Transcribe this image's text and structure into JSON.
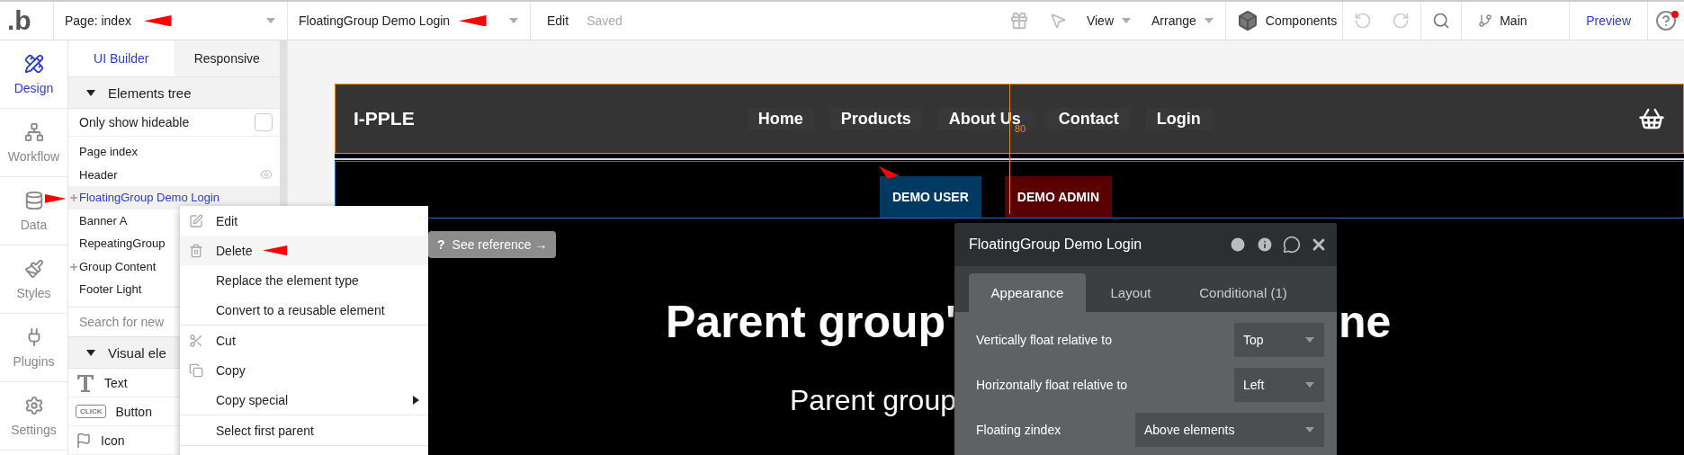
{
  "topbar": {
    "logo": ".b",
    "page_selector": "Page: index",
    "element_selector": "FloatingGroup Demo Login",
    "edit": "Edit",
    "save_status": "Saved",
    "view": "View",
    "arrange": "Arrange",
    "components": "Components",
    "branch": "Main",
    "preview": "Preview",
    "help_badge": true
  },
  "rail": [
    {
      "label": "Design",
      "selected": true
    },
    {
      "label": "Workflow",
      "selected": false
    },
    {
      "label": "Data",
      "selected": false
    },
    {
      "label": "Styles",
      "selected": false
    },
    {
      "label": "Plugins",
      "selected": false
    },
    {
      "label": "Settings",
      "selected": false
    }
  ],
  "panel": {
    "tabs": [
      {
        "label": "UI Builder",
        "selected": true
      },
      {
        "label": "Responsive",
        "selected": false
      }
    ],
    "tree_section": {
      "title": "Elements tree",
      "expanded": true
    },
    "hideable": {
      "label": "Only show hideable",
      "checked": false
    },
    "tree": [
      {
        "label": "Page index",
        "selected": false,
        "expandable": false,
        "eye": false
      },
      {
        "label": "Header",
        "selected": false,
        "expandable": false,
        "eye": true
      },
      {
        "label": "FloatingGroup Demo Login",
        "selected": true,
        "expandable": true,
        "eye": false
      },
      {
        "label": "Banner A",
        "selected": false,
        "expandable": false
      },
      {
        "label": "RepeatingGroup",
        "selected": false,
        "expandable": false
      },
      {
        "label": "Group Content",
        "selected": false,
        "expandable": true
      },
      {
        "label": "Footer Light",
        "selected": false,
        "expandable": false
      }
    ],
    "search": {
      "placeholder": "Search for new"
    },
    "visual_section": {
      "title": "Visual ele",
      "expanded": true
    },
    "elements": [
      {
        "kind": "text",
        "label": "Text"
      },
      {
        "kind": "button",
        "label": "Button",
        "badge": "CLICK"
      },
      {
        "kind": "icon",
        "label": "Icon"
      }
    ]
  },
  "canvas": {
    "logo": "I-PPLE",
    "nav": [
      "Home",
      "Products",
      "About Us",
      "Contact",
      "Login"
    ],
    "guide_label": "80",
    "demo_buttons": [
      {
        "label": "DEMO USER",
        "color": "#003a63"
      },
      {
        "label": "DEMO ADMIN",
        "color": "#5a0000"
      }
    ],
    "heading_left": "Parent group'",
    "heading_right": "ne",
    "subheading": "Parent group"
  },
  "context_menu": {
    "groups": [
      [
        {
          "kind": "edit",
          "label": "Edit",
          "selected": false,
          "submenu": false
        },
        {
          "kind": "delete",
          "label": "Delete",
          "selected": true,
          "submenu": false
        },
        {
          "kind": "plain",
          "label": "Replace the element type",
          "selected": false,
          "submenu": false
        },
        {
          "kind": "plain",
          "label": "Convert to a reusable element",
          "selected": false,
          "submenu": false
        }
      ],
      [
        {
          "kind": "cut",
          "label": "Cut",
          "selected": false,
          "submenu": false
        },
        {
          "kind": "copy",
          "label": "Copy",
          "selected": false,
          "submenu": false
        },
        {
          "kind": "plain",
          "label": "Copy special",
          "selected": false,
          "submenu": true
        }
      ],
      [
        {
          "kind": "plain",
          "label": "Select first parent",
          "selected": false,
          "submenu": false
        }
      ]
    ]
  },
  "tooltip": {
    "mark": "?",
    "text": "See reference →"
  },
  "property_panel": {
    "title": "FloatingGroup Demo Login",
    "tabs": [
      {
        "label": "Appearance",
        "selected": true
      },
      {
        "label": "Layout",
        "selected": false
      },
      {
        "label": "Conditional (1)",
        "selected": false
      }
    ],
    "fields": [
      {
        "kind": "narrow",
        "label": "Vertically float relative to",
        "value": "Top"
      },
      {
        "kind": "narrow",
        "label": "Horizontally float relative to",
        "value": "Left"
      },
      {
        "kind": "wide",
        "label": "Floating zindex",
        "value": "Above elements"
      }
    ]
  }
}
